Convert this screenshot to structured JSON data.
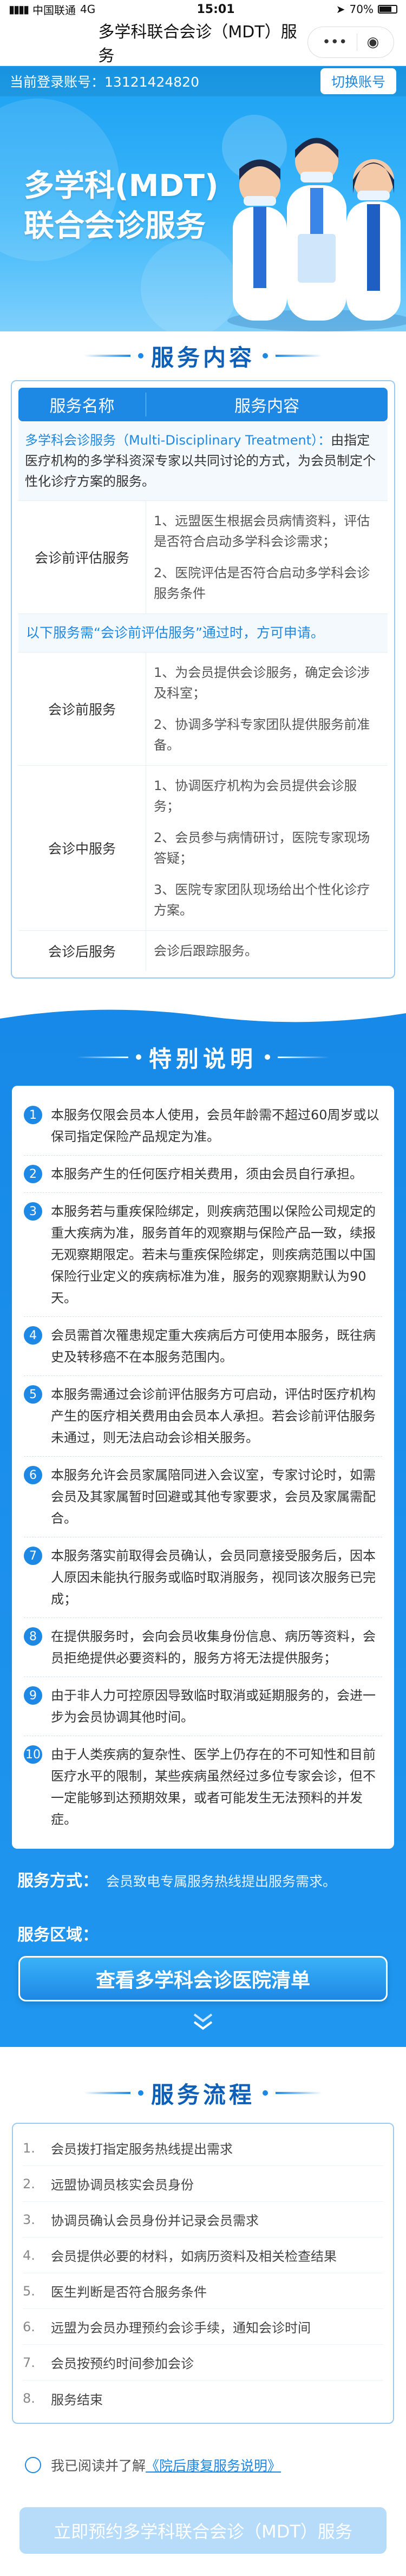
{
  "status_bar": {
    "carrier": "中国联通",
    "network": "4G",
    "time": "15:01",
    "battery": "70%"
  },
  "navbar": {
    "title": "多学科联合会诊（MDT）服务",
    "more_icon": "more-dots-icon",
    "close_icon": "close-circle-icon"
  },
  "account": {
    "label": "当前登录账号：",
    "phone": "13121424820",
    "switch_label": "切换账号"
  },
  "hero": {
    "title_line1": "多学科(MDT)",
    "title_line2": "联合会诊服务"
  },
  "service_content": {
    "section_title": "服务内容",
    "col_name": "服务名称",
    "col_content": "服务内容",
    "intro_lead": "多学科会诊服务（Multi-Disciplinary Treatment）：",
    "intro_body": "由指定医疗机构的多学科资深专家以共同讨论的方式，为会员制定个性化诊疗方案的服务。",
    "pre_eval": {
      "name": "会诊前评估服务",
      "items": [
        "1、远盟医生根据会员病情资料，评估是否符合启动多学科会诊需求；",
        "2、医院评估是否符合启动多学科会诊服务条件"
      ]
    },
    "notice": "以下服务需“会诊前评估服务”通过时，方可申请。",
    "rows": [
      {
        "name": "会诊前服务",
        "items": [
          "1、为会员提供会诊服务，确定会诊涉及科室；",
          "2、协调多学科专家团队提供服务前准备。"
        ]
      },
      {
        "name": "会诊中服务",
        "items": [
          "1、协调医疗机构为会员提供会诊服务；",
          "2、会员参与病情研讨，医院专家现场答疑；",
          "3、医院专家团队现场给出个性化诊疗方案。"
        ]
      },
      {
        "name": "会诊后服务",
        "items": [
          "会诊后跟踪服务。"
        ]
      }
    ]
  },
  "special_notes": {
    "section_title": "特别说明",
    "items": [
      "本服务仅限会员本人使用，会员年龄需不超过60周岁或以保司指定保险产品规定为准。",
      "本服务产生的任何医疗相关费用，须由会员自行承担。",
      "本服务若与重疾保险绑定，则疾病范围以保险公司规定的重大疾病为准，服务首年的观察期与保险产品一致，续报无观察期限定。若未与重疾保险绑定，则疾病范围以中国保险行业定义的疾病标准为准，服务的观察期默认为90天。",
      "会员需首次罹患规定重大疾病后方可使用本服务，既往病史及转移癌不在本服务范围内。",
      "本服务需通过会诊前评估服务方可启动，评估时医疗机构产生的医疗相关费用由会员本人承担。若会诊前评估服务未通过，则无法启动会诊相关服务。",
      "本服务允许会员家属陪同进入会议室，专家讨论时，如需会员及其家属暂时回避或其他专家要求，会员及家属需配合。",
      "本服务落实前取得会员确认，会员同意接受服务后，因本人原因未能执行服务或临时取消服务，视同该次服务已完成；",
      "在提供服务时，会向会员收集身份信息、病历等资料，会员拒绝提供必要资料的，服务方将无法提供服务；",
      "由于非人力可控原因导致临时取消或延期服务的，会进一步为会员协调其他时间。",
      "由于人类疾病的复杂性、医学上仍存在的不可知性和目前医疗水平的限制，某些疾病虽然经过多位专家会诊，但不一定能够到达预期效果，或者可能发生无法预料的并发症。"
    ]
  },
  "service_method": {
    "label": "服务方式：",
    "value": "会员致电专属服务热线提出服务需求。"
  },
  "service_region": {
    "label": "服务区域：",
    "button": "查看多学科会诊医院清单"
  },
  "flow": {
    "section_title": "服务流程",
    "items": [
      {
        "n": "1.",
        "text": "会员拨打指定服务热线提出需求"
      },
      {
        "n": "2.",
        "text": "远盟协调员核实会员身份"
      },
      {
        "n": "3.",
        "text": "协调员确认会员身份并记录会员需求"
      },
      {
        "n": "4.",
        "text": "会员提供必要的材料，如病历资料及相关检查结果"
      },
      {
        "n": "5.",
        "text": "医生判断是否符合服务条件"
      },
      {
        "n": "6.",
        "text": "远盟为会员办理预约会诊手续，通知会诊时间"
      },
      {
        "n": "7.",
        "text": "会员按预约时间参加会诊"
      },
      {
        "n": "8.",
        "text": "服务结束"
      }
    ]
  },
  "agreement": {
    "prefix": "我已阅读并了解",
    "link": "《院后康复服务说明》"
  },
  "submit_label": "立即预约多学科联合会诊（MDT）服务",
  "colors": {
    "primary": "#1e88e5",
    "hero_bg": "#1aa0f2",
    "notes_bg": "#1789e8"
  }
}
